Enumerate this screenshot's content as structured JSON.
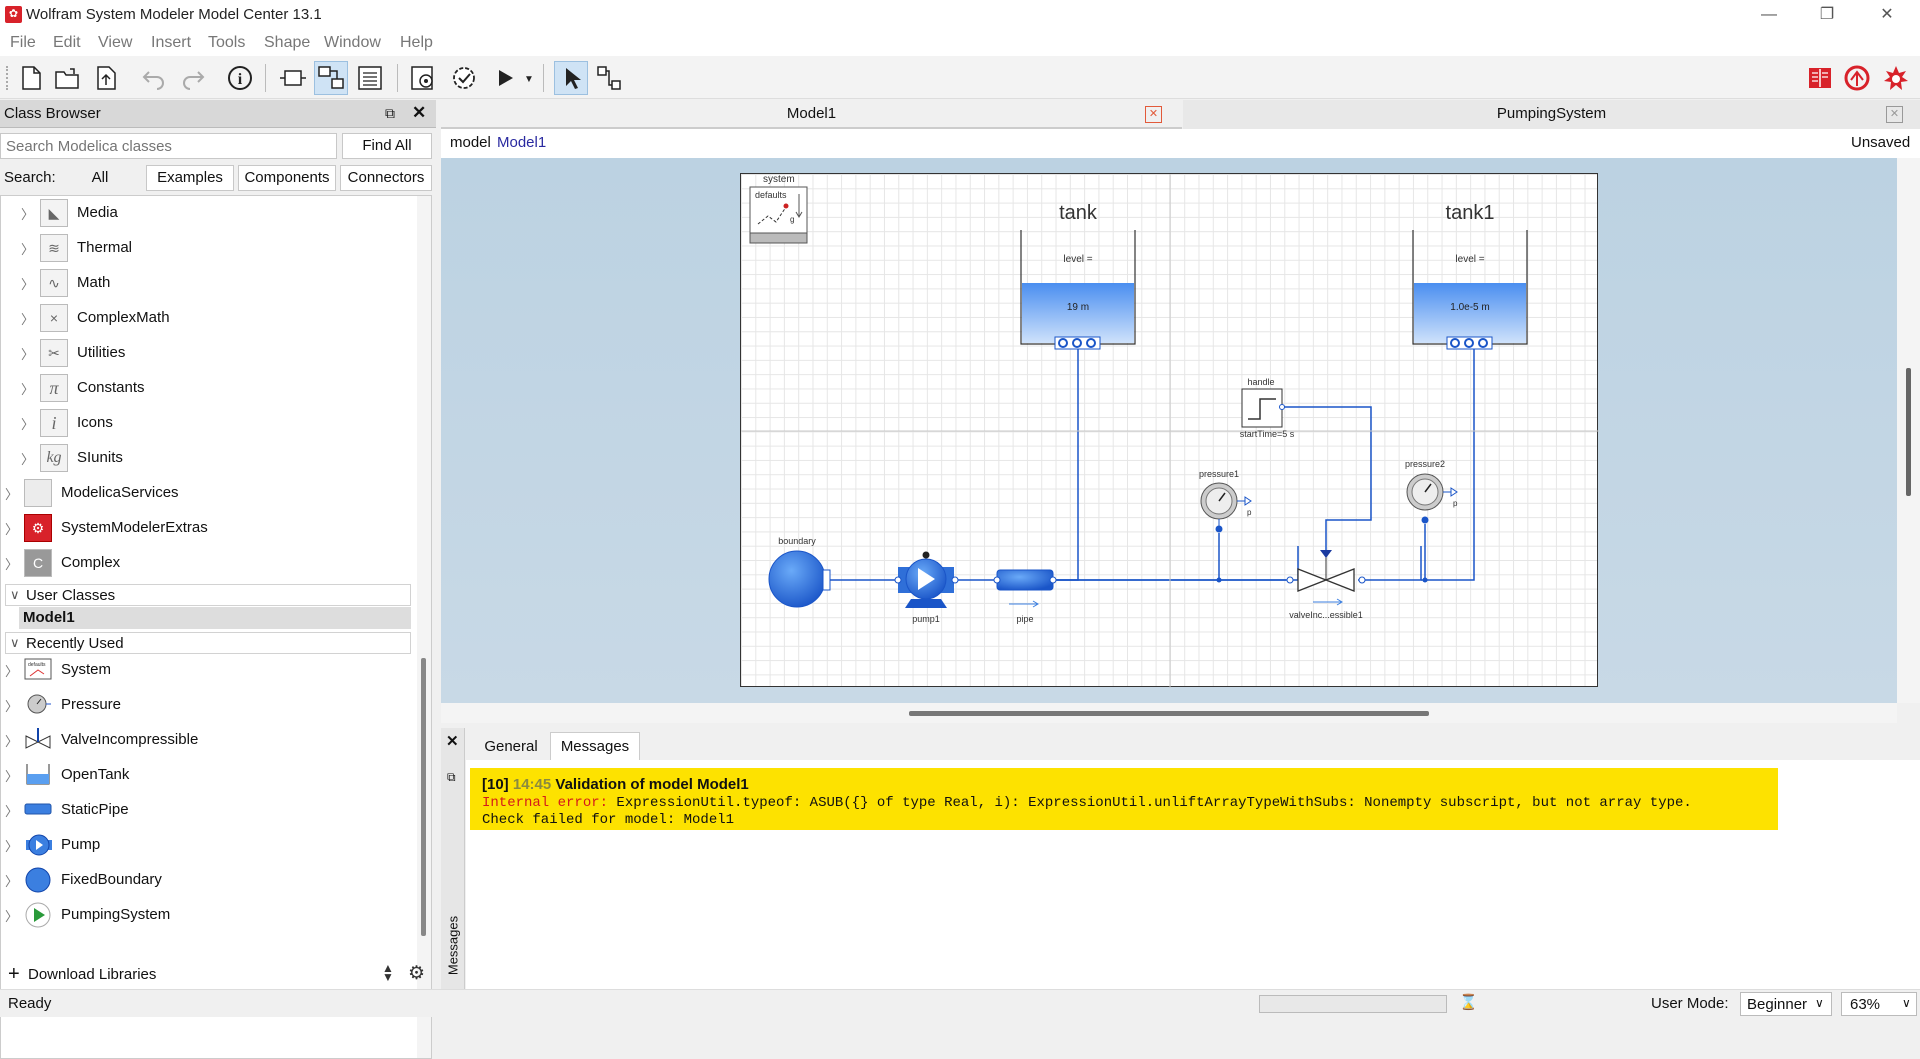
{
  "window": {
    "title": "Wolfram System Modeler Model Center 13.1",
    "min": "—",
    "max": "❐",
    "close": "✕"
  },
  "menu": [
    "File",
    "Edit",
    "View",
    "Insert",
    "Tools",
    "Shape",
    "Window",
    "Help"
  ],
  "toolbar": {
    "icons": [
      "new-file-icon",
      "open-folder-icon",
      "save-icon",
      "undo-icon",
      "redo-icon",
      "info-icon",
      "icon-view-icon",
      "diagram-view-icon",
      "text-view-icon",
      "simulation-settings-icon",
      "validate-icon",
      "simulate-icon",
      "pointer-icon",
      "connector-icon",
      "documentation-icon",
      "wolfram-spikey-icon",
      "wolfram-star-icon"
    ]
  },
  "class_browser": {
    "title": "Class Browser",
    "search_placeholder": "Search Modelica classes",
    "find_all": "Find All",
    "search_label": "Search:",
    "filters": [
      "All",
      "Examples",
      "Components",
      "Connectors"
    ],
    "tree": [
      {
        "label": "Media",
        "glyph": "◣"
      },
      {
        "label": "Thermal",
        "glyph": "≋"
      },
      {
        "label": "Math",
        "glyph": "∿"
      },
      {
        "label": "ComplexMath",
        "glyph": "×"
      },
      {
        "label": "Utilities",
        "glyph": "✂"
      },
      {
        "label": "Constants",
        "glyph": "π"
      },
      {
        "label": "Icons",
        "glyph": "i"
      },
      {
        "label": "SIunits",
        "glyph": "kg"
      }
    ],
    "top_tree": [
      {
        "label": "ModelicaServices",
        "glyph": ""
      },
      {
        "label": "SystemModelerExtras",
        "glyph": "⚙"
      },
      {
        "label": "Complex",
        "glyph": "C"
      }
    ],
    "user_classes": "User Classes",
    "user_model": "Model1",
    "recently_used": "Recently Used",
    "recent": [
      "System",
      "Pressure",
      "ValveIncompressible",
      "OpenTank",
      "StaticPipe",
      "Pump",
      "FixedBoundary",
      "PumpingSystem"
    ],
    "download": "Download Libraries"
  },
  "editor": {
    "tabs": [
      "Model1",
      "PumpingSystem"
    ],
    "keyword": "model",
    "model_name": "Model1",
    "status": "Unsaved"
  },
  "diagram": {
    "system_label": "system",
    "system_defaults": "defaults",
    "system_g": "g",
    "tank_label": "tank",
    "tank_level": "level =",
    "tank_value": "19 m",
    "tank1_label": "tank1",
    "tank1_level": "level =",
    "tank1_value": "1.0e-5 m",
    "handle_label": "handle",
    "handle_param": "startTime=5 s",
    "pressure1": "pressure1",
    "pressure2": "pressure2",
    "p": "p",
    "boundary": "boundary",
    "pump1": "pump1",
    "pipe": "pipe",
    "valve": "valveInc...essible1"
  },
  "messages": {
    "tabs": [
      "General",
      "Messages"
    ],
    "side_label": "Messages",
    "entry_index": "[10]",
    "entry_time": "14:45",
    "entry_title": "Validation of model Model1",
    "error_prefix": "Internal error:",
    "error_text": " ExpressionUtil.typeof: ASUB({} of type Real, i): ExpressionUtil.unliftArrayTypeWithSubs: Nonempty subscript, but not array type.",
    "check_failed": "Check failed for model: Model1"
  },
  "status": {
    "text": "Ready",
    "user_mode_label": "User Mode:",
    "user_mode": "Beginner",
    "zoom": "63%"
  }
}
